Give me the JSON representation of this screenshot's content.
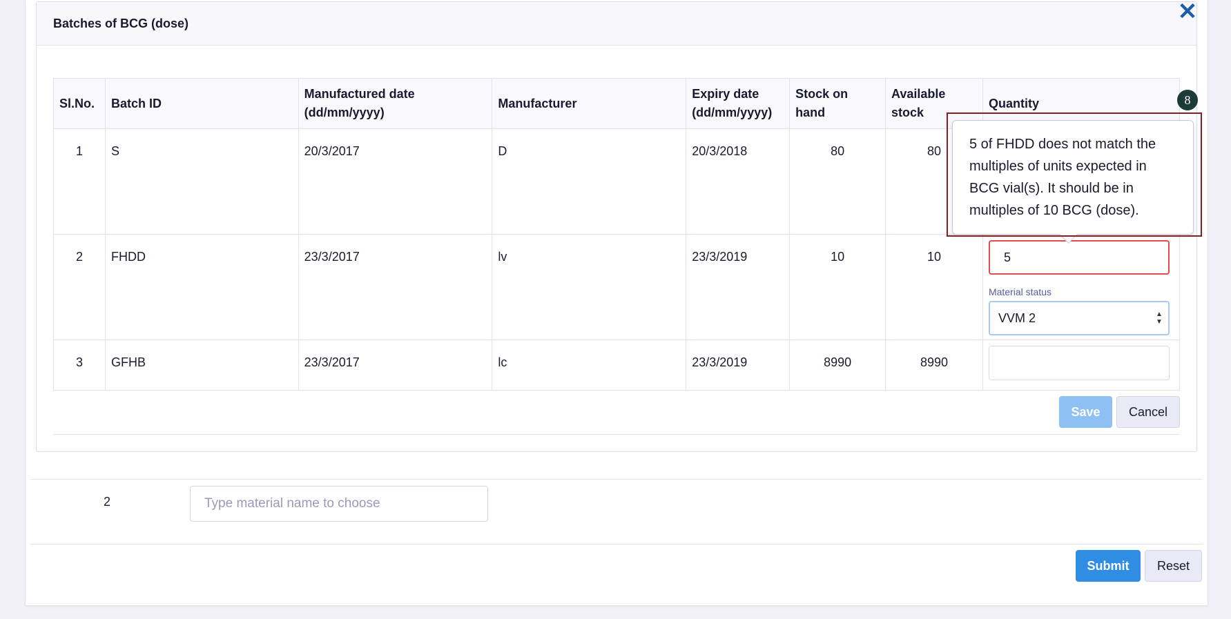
{
  "dialog": {
    "title": "Batches of BCG (dose)"
  },
  "table": {
    "headers": {
      "slno": "Sl.No.",
      "batch_id": "Batch ID",
      "mfg_date": "Manufactured date",
      "mfg_date_fmt": "(dd/mm/yyyy)",
      "manufacturer": "Manufacturer",
      "expiry_date": "Expiry date",
      "expiry_date_fmt": "(dd/mm/yyyy)",
      "stock_on_hand_1": "Stock on",
      "stock_on_hand_2": "hand",
      "available_stock_1": "Available",
      "available_stock_2": "stock",
      "quantity": "Quantity"
    },
    "rows": [
      {
        "slno": "1",
        "batch_id": "S",
        "mfg_date": "20/3/2017",
        "manufacturer": "D",
        "expiry_date": "20/3/2018",
        "stock_on_hand": "80",
        "available_stock": "80",
        "quantity": ""
      },
      {
        "slno": "2",
        "batch_id": "FHDD",
        "mfg_date": "23/3/2017",
        "manufacturer": "lv",
        "expiry_date": "23/3/2019",
        "stock_on_hand": "10",
        "available_stock": "10",
        "quantity": "5"
      },
      {
        "slno": "3",
        "batch_id": "GFHB",
        "mfg_date": "23/3/2017",
        "manufacturer": "lc",
        "expiry_date": "23/3/2019",
        "stock_on_hand": "8990",
        "available_stock": "8990",
        "quantity": ""
      }
    ],
    "material_status_label": "Material status",
    "material_status_value": "VVM 2"
  },
  "tooltip": {
    "line1": "5 of FHDD does not match the",
    "line2": "multiples of units expected in",
    "line3": "BCG vial(s). It should be in",
    "line4": "multiples of 10 BCG (dose)."
  },
  "step_badge": "8",
  "buttons": {
    "save": "Save",
    "cancel": "Cancel",
    "submit": "Submit",
    "reset": "Reset",
    "close": "✕"
  },
  "material_row": {
    "number": "2",
    "placeholder": "Type material name to choose"
  },
  "colors": {
    "primary": "#2f8de4",
    "primary_disabled": "#8ec0f4",
    "error": "#e04b4b",
    "close_icon": "#1f5fa8",
    "highlight": "#8b1d1d"
  }
}
